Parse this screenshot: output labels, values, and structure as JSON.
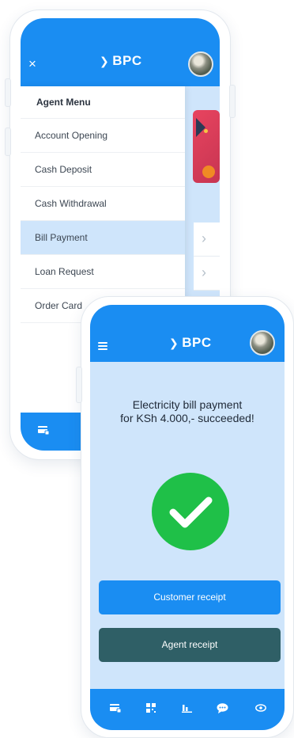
{
  "brand": {
    "name": "BPC",
    "chevron": "❯"
  },
  "back_phone": {
    "close_icon": "×",
    "menu": {
      "title": "Agent Menu",
      "items": [
        {
          "label": "Account Opening"
        },
        {
          "label": "Cash Deposit"
        },
        {
          "label": "Cash Withdrawal"
        },
        {
          "label": "Bill Payment",
          "active": true
        },
        {
          "label": "Loan Request"
        },
        {
          "label": "Order Card"
        }
      ]
    },
    "peek_rows": [
      "›",
      "›"
    ]
  },
  "front_phone": {
    "message_line1": "Electricity bill payment",
    "message_line2": "for KSh 4.000,- succeeded!",
    "buttons": {
      "customer_receipt": "Customer receipt",
      "agent_receipt": "Agent receipt"
    },
    "nav_icons": [
      "card-icon",
      "qr-icon",
      "chart-icon",
      "chat-icon",
      "eye-icon"
    ]
  },
  "colors": {
    "primary": "#1a8df2",
    "screen_bg": "#cfe5fb",
    "success": "#1fc048",
    "agent_button": "#2f5f66"
  }
}
